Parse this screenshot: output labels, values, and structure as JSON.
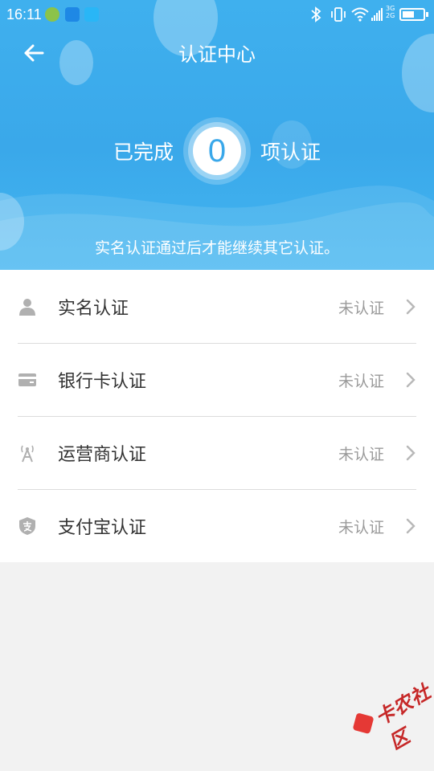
{
  "status_bar": {
    "time": "16:11",
    "network_label": "3G 2G"
  },
  "nav": {
    "title": "认证中心"
  },
  "progress": {
    "prefix": "已完成",
    "count": "0",
    "suffix": "项认证"
  },
  "hint": "实名认证通过后才能继续其它认证。",
  "items": [
    {
      "label": "实名认证",
      "status": "未认证",
      "icon": "person-icon"
    },
    {
      "label": "银行卡认证",
      "status": "未认证",
      "icon": "bank-card-icon"
    },
    {
      "label": "运营商认证",
      "status": "未认证",
      "icon": "signal-tower-icon"
    },
    {
      "label": "支付宝认证",
      "status": "未认证",
      "icon": "alipay-shield-icon"
    }
  ],
  "watermark": "卡农社区",
  "colors": {
    "header_blue": "#3aa8ea",
    "icon_gray": "#b0b0b0",
    "status_gray": "#9a9a9a",
    "watermark_red": "#c62828"
  }
}
